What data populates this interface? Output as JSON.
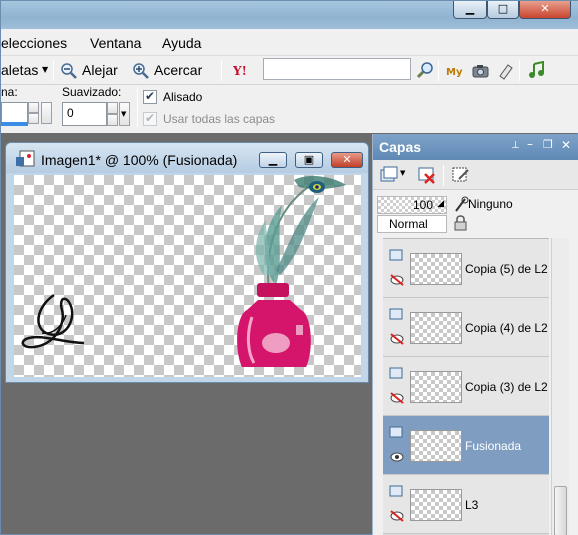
{
  "menubar": {
    "items": [
      "elecciones",
      "Ventana",
      "Ayuda"
    ]
  },
  "toolbar": {
    "paletas_label": "aletas",
    "alejar_label": "Alejar",
    "acercar_label": "Acercar",
    "search_value": ""
  },
  "options": {
    "partial_label": "na:",
    "suavizado_label": "Suavizado:",
    "suavizado_value": "0",
    "alisado_label": "Alisado",
    "alisado_checked": true,
    "usar_todas_label": "Usar todas las capas",
    "usar_todas_checked": true
  },
  "image_window": {
    "title": "Imagen1* @ 100% (Fusionada)"
  },
  "capas": {
    "title": "Capas",
    "opacity": "100",
    "mask_label": "Ninguno",
    "blend_mode": "Normal",
    "layers": [
      {
        "name": "Copia (5) de L2",
        "selected": false
      },
      {
        "name": "Copia (4) de L2",
        "selected": false
      },
      {
        "name": "Copia (3) de L2",
        "selected": false
      },
      {
        "name": "Fusionada",
        "selected": true
      },
      {
        "name": "L3",
        "selected": false
      }
    ]
  },
  "colors": {
    "selected_layer": "#7e9dc1",
    "panel_title": "#5f89b5",
    "workspace": "#6b6b6b",
    "ink_bottle": "#d4156b"
  }
}
